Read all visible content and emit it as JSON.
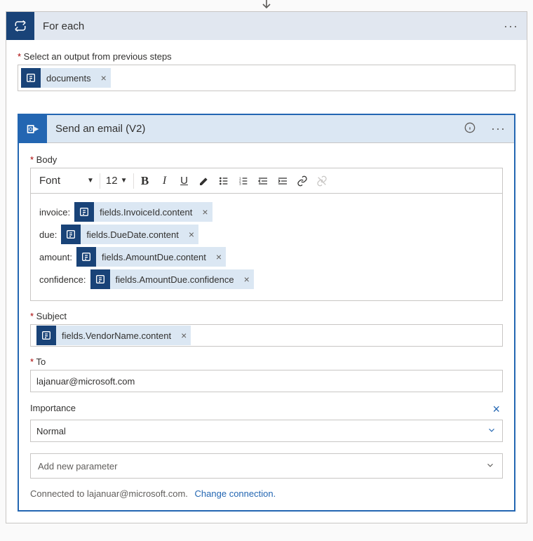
{
  "forEach": {
    "title": "For each",
    "outputLabel": "Select an output from previous steps",
    "outputToken": "documents"
  },
  "sendEmail": {
    "title": "Send an email (V2)",
    "bodyLabel": "Body",
    "toolbar": {
      "font": "Font",
      "size": "12"
    },
    "bodyRows": [
      {
        "label": "invoice:",
        "token": "fields.InvoiceId.content"
      },
      {
        "label": "due:",
        "token": "fields.DueDate.content"
      },
      {
        "label": "amount:",
        "token": "fields.AmountDue.content"
      },
      {
        "label": "confidence:",
        "token": "fields.AmountDue.confidence"
      }
    ],
    "subjectLabel": "Subject",
    "subjectToken": "fields.VendorName.content",
    "toLabel": "To",
    "toValue": "lajanuar@microsoft.com",
    "importanceLabel": "Importance",
    "importanceValue": "Normal",
    "addParam": "Add new parameter",
    "connectedText": "Connected to lajanuar@microsoft.com.",
    "changeConnection": "Change connection."
  }
}
